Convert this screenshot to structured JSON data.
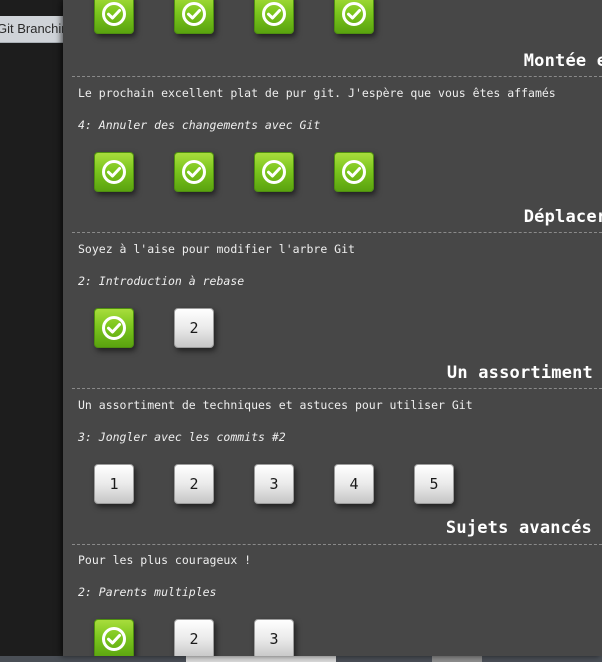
{
  "background": {
    "tab_label": "Git Branching"
  },
  "colors": {
    "dialog_bg": "#474747",
    "completed_green": "#7cc61e",
    "pending_gray": "#eaeaea"
  },
  "sections": [
    {
      "title": "",
      "description": "",
      "current_level": "",
      "levels": [
        {
          "status": "completed",
          "label": ""
        },
        {
          "status": "completed",
          "label": ""
        },
        {
          "status": "completed",
          "label": ""
        },
        {
          "status": "completed",
          "label": ""
        }
      ]
    },
    {
      "title": "Montée en puissance",
      "description": "Le prochain excellent plat de pur git. J'espère que vous êtes affamés",
      "current_level": "4: Annuler des changements avec Git",
      "levels": [
        {
          "status": "completed",
          "label": ""
        },
        {
          "status": "completed",
          "label": ""
        },
        {
          "status": "completed",
          "label": ""
        },
        {
          "status": "completed",
          "label": ""
        }
      ]
    },
    {
      "title": "Déplacer le travail",
      "description": "Soyez à l'aise pour modifier l'arbre Git",
      "current_level": "2: Introduction à rebase",
      "levels": [
        {
          "status": "completed",
          "label": ""
        },
        {
          "status": "pending",
          "label": "2"
        }
      ]
    },
    {
      "title": "Un assortiment",
      "description": "Un assortiment de techniques et astuces pour utiliser Git",
      "current_level": "3: Jongler avec les commits #2",
      "levels": [
        {
          "status": "pending",
          "label": "1"
        },
        {
          "status": "pending",
          "label": "2"
        },
        {
          "status": "pending",
          "label": "3"
        },
        {
          "status": "pending",
          "label": "4"
        },
        {
          "status": "pending",
          "label": "5"
        }
      ]
    },
    {
      "title": "Sujets avancés",
      "description": "Pour les plus courageux !",
      "current_level": "2: Parents multiples",
      "levels": [
        {
          "status": "completed",
          "label": ""
        },
        {
          "status": "pending",
          "label": "2"
        },
        {
          "status": "pending",
          "label": "3"
        }
      ]
    }
  ]
}
